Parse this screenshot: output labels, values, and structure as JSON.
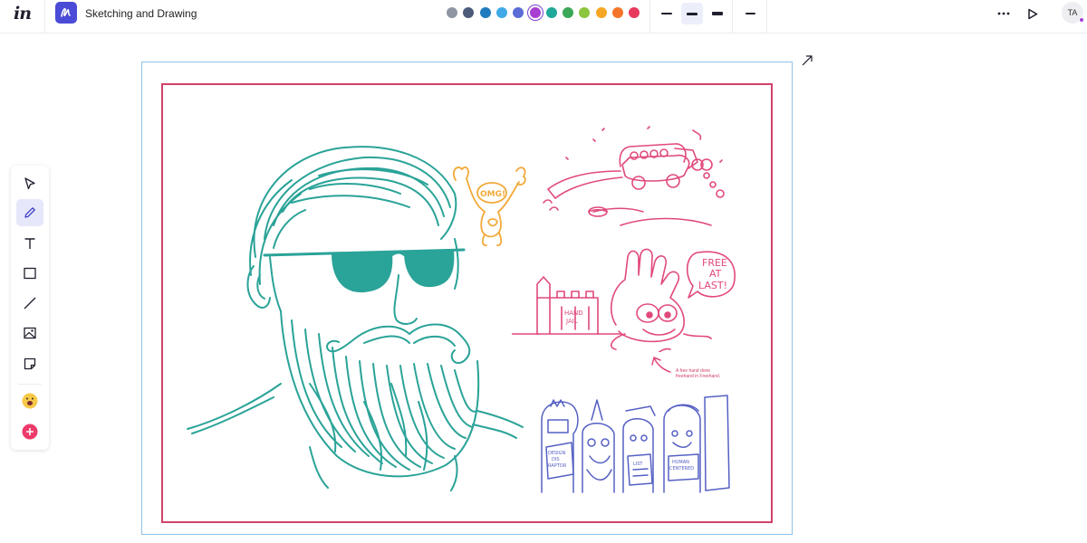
{
  "header": {
    "brand": "in",
    "title": "Sketching and Drawing"
  },
  "palette": {
    "colors": [
      "#8f96a3",
      "#4d5b7a",
      "#1f7bbd",
      "#3fa9e8",
      "#5b6cd6",
      "#a83fd0",
      "#20a89a",
      "#3aa856",
      "#8cc63f",
      "#f5a623",
      "#f4742b",
      "#e8395d"
    ],
    "selected_index": 5
  },
  "strokes": {
    "options": [
      "thin",
      "medium",
      "thick",
      "extra-thin"
    ],
    "selected_index": 1
  },
  "user": {
    "initials": "TA",
    "presence_color": "#a041d6"
  },
  "tools": [
    {
      "name": "select-tool",
      "icon": "cursor-icon"
    },
    {
      "name": "pen-tool",
      "icon": "pen-icon",
      "active": true
    },
    {
      "name": "text-tool",
      "icon": "text-icon"
    },
    {
      "name": "rectangle-tool",
      "icon": "rectangle-icon"
    },
    {
      "name": "line-tool",
      "icon": "line-icon"
    },
    {
      "name": "image-tool",
      "icon": "image-icon"
    },
    {
      "name": "sticky-note-tool",
      "icon": "sticky-note-icon"
    },
    {
      "name": "emoji-tool",
      "icon": "emoji-icon"
    },
    {
      "name": "add-tool",
      "icon": "plus-icon"
    }
  ],
  "canvas": {
    "frame_color": "#8ec2e6",
    "inner_border_color": "#d0426a",
    "sketches": {
      "omg_bubble": "OMG!",
      "hand_jail_sign_line1": "HAND",
      "hand_jail_sign_line2": "JAIL",
      "free_line1": "FREE",
      "free_line2": "AT",
      "free_line3": "LAST!",
      "note_line1": "A free hand done",
      "note_line2": "freehand in Freehand.",
      "sign_left_line1": "DESIGN",
      "sign_left_line2": "DIS",
      "sign_left_line3": "RAPTOR",
      "sign_mid": "LIST",
      "sign_right_line1": "HUMAN",
      "sign_right_line2": "CENTERED"
    },
    "colors": {
      "portrait": "#2aa398",
      "doodle_orange": "#f2a93a",
      "doodle_pink": "#e0497c",
      "doodle_blue": "#5560c4"
    }
  }
}
